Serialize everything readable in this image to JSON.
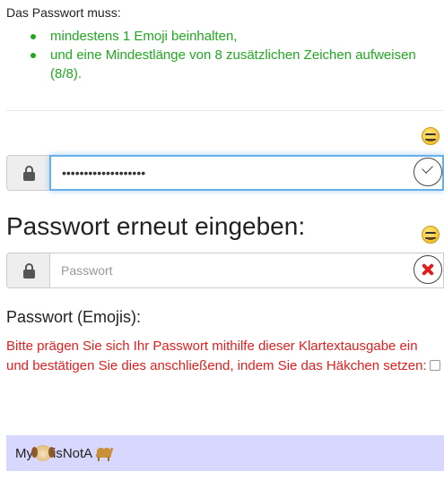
{
  "requirements": {
    "intro": "Das Passwort muss:",
    "items": [
      "mindestens 1 Emoji beinhalten,",
      "und eine Mindestlänge von 8 zusätzlichen Zeichen aufweisen (8/8)."
    ]
  },
  "password": {
    "value": "•••••••••••••••••••",
    "emoji_icon": "nerd-face-icon",
    "lock_icon": "lock-icon",
    "status_icon": "check-circle-icon"
  },
  "repeat": {
    "title": "Passwort erneut eingeben:",
    "placeholder": "Passwort",
    "emoji_icon": "nerd-face-icon",
    "lock_icon": "lock-icon",
    "status_icon": "cross-mark-icon"
  },
  "emoji_section": {
    "title": "Passwort (Emojis):",
    "warning": "Bitte prägen Sie sich Ihr Passwort mithilfe dieser Klartextausgabe ein und bestätigen Sie dies anschließend, indem Sie das Häkchen setzen:",
    "output": {
      "part1": "My",
      "part2": "isNotA",
      "icon1": "dog-face-icon",
      "icon2": "camel-icon"
    }
  },
  "colors": {
    "success": "#22a722",
    "error": "#e02020",
    "focus": "#66afe9",
    "output_bg": "#d8d8ff"
  }
}
